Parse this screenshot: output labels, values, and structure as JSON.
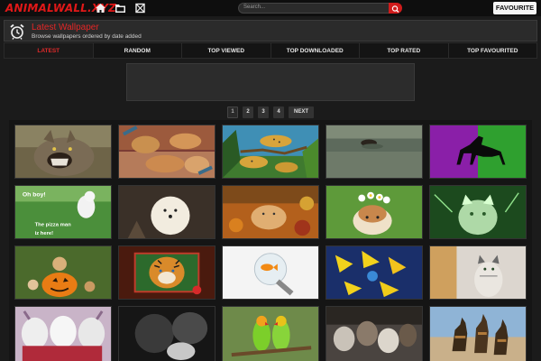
{
  "topbar": {
    "logo": "ANIMALWALL.XYZ",
    "search_placeholder": "Search...",
    "favourite_label": "FAVOURITE"
  },
  "header": {
    "title": "Latest Wallpaper",
    "subtitle": "Browse wallpapers ordered by date added"
  },
  "tabs": [
    {
      "label": "LATEST",
      "active": true
    },
    {
      "label": "RANDOM"
    },
    {
      "label": "TOP VIEWED"
    },
    {
      "label": "TOP DOWNLOADED"
    },
    {
      "label": "TOP RATED"
    },
    {
      "label": "TOP FAVOURITED"
    }
  ],
  "pagination": {
    "pages": [
      "1",
      "2",
      "3",
      "4"
    ],
    "next": "NEXT",
    "current": "1"
  },
  "thumbnails": {
    "t6_caption_1": "Oh boy!",
    "t6_caption_2": "The pizza man",
    "t6_caption_3": "iz here!"
  },
  "colors": {
    "accent": "#e01818",
    "background": "#1b1b1b"
  },
  "icons": [
    "home-icon",
    "folder-icon",
    "random-icon",
    "search-icon",
    "alarm-clock-icon"
  ]
}
